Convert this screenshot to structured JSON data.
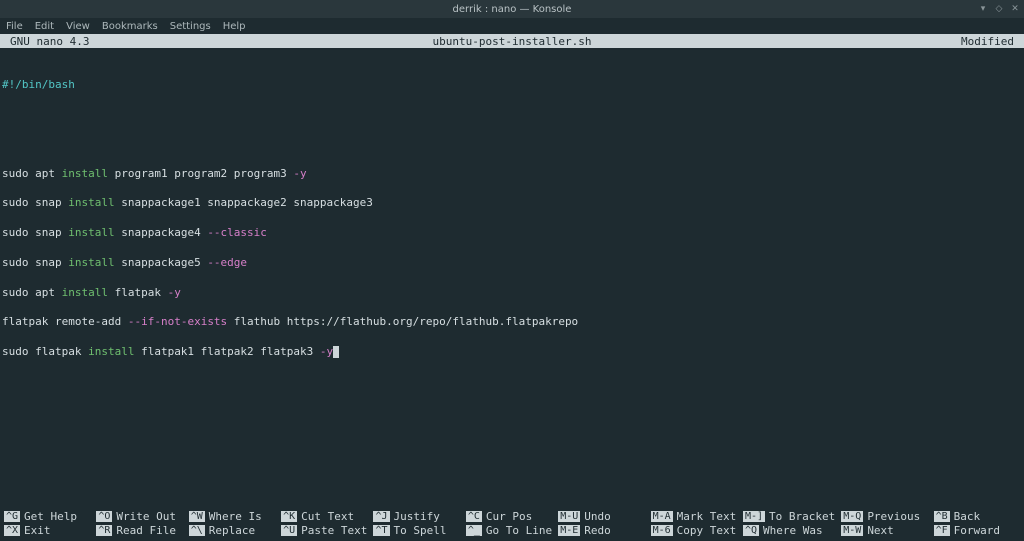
{
  "window": {
    "title": "derrik : nano — Konsole"
  },
  "menu": {
    "file": "File",
    "edit": "Edit",
    "view": "View",
    "bookmarks": "Bookmarks",
    "settings": "Settings",
    "help": "Help"
  },
  "nano": {
    "version": "GNU nano 4.3",
    "filename": "ubuntu-post-installer.sh",
    "modified": "Modified"
  },
  "script": {
    "shebang": "#!/bin/bash",
    "lines": [
      {
        "p": "sudo apt ",
        "kw": "install",
        "a": " program1 program2 program3 ",
        "f": "-y"
      },
      {
        "p": "sudo snap ",
        "kw": "install",
        "a": " snappackage1 snappackage2 snappackage3",
        "f": ""
      },
      {
        "p": "sudo snap ",
        "kw": "install",
        "a": " snappackage4 ",
        "f": "--classic"
      },
      {
        "p": "sudo snap ",
        "kw": "install",
        "a": " snappackage5 ",
        "f": "--edge"
      },
      {
        "p": "sudo apt ",
        "kw": "install",
        "a": " flatpak ",
        "f": "-y"
      },
      {
        "p": "flatpak remote-add ",
        "kw": "",
        "f": "--if-not-exists",
        "a": " flathub https://flathub.org/repo/flathub.flatpakrepo"
      },
      {
        "p": "sudo flatpak ",
        "kw": "install",
        "a": " flatpak1 flatpak2 flatpak3 ",
        "f": "-y",
        "cursor": true
      }
    ]
  },
  "shortcuts": {
    "row1": [
      {
        "key": "^G",
        "label": "Get Help"
      },
      {
        "key": "^O",
        "label": "Write Out"
      },
      {
        "key": "^W",
        "label": "Where Is"
      },
      {
        "key": "^K",
        "label": "Cut Text"
      },
      {
        "key": "^J",
        "label": "Justify"
      },
      {
        "key": "^C",
        "label": "Cur Pos"
      },
      {
        "key": "M-U",
        "label": "Undo"
      },
      {
        "key": "M-A",
        "label": "Mark Text"
      }
    ],
    "row1b": [
      {
        "key": "M-]",
        "label": "To Bracket"
      },
      {
        "key": "M-Q",
        "label": "Previous"
      },
      {
        "key": "^B",
        "label": "Back"
      }
    ],
    "row2": [
      {
        "key": "^X",
        "label": "Exit"
      },
      {
        "key": "^R",
        "label": "Read File"
      },
      {
        "key": "^\\",
        "label": "Replace"
      },
      {
        "key": "^U",
        "label": "Paste Text"
      },
      {
        "key": "^T",
        "label": "To Spell"
      },
      {
        "key": "^_",
        "label": "Go To Line"
      },
      {
        "key": "M-E",
        "label": "Redo"
      },
      {
        "key": "M-6",
        "label": "Copy Text"
      }
    ],
    "row2b": [
      {
        "key": "^Q",
        "label": "Where Was"
      },
      {
        "key": "M-W",
        "label": "Next"
      },
      {
        "key": "^F",
        "label": "Forward"
      }
    ]
  }
}
